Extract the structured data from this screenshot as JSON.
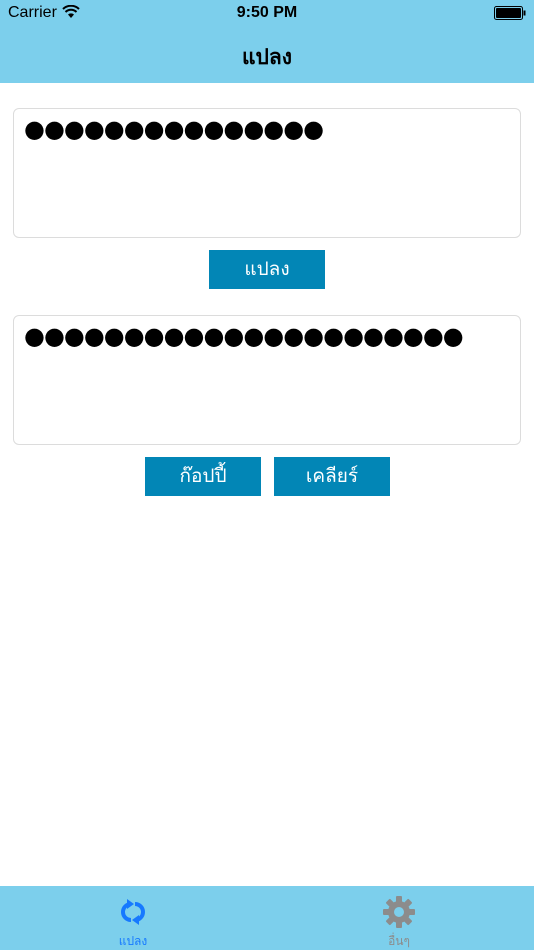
{
  "status_bar": {
    "carrier": "Carrier",
    "time": "9:50 PM"
  },
  "nav": {
    "title": "แปลง"
  },
  "input_box": {
    "value": "●●●●●●●●●●●●●●●"
  },
  "buttons": {
    "convert": "แปลง",
    "copy": "ก๊อปปี้",
    "clear": "เคลียร์"
  },
  "output_box": {
    "value": "●●●●●●●●●●●●●●●●●●●●●●"
  },
  "tabs": [
    {
      "label": "แปลง",
      "icon": "convert-arrows-icon",
      "selected": true
    },
    {
      "label": "อื่นๆ",
      "icon": "gear-icon",
      "selected": false
    }
  ],
  "colors": {
    "bar_background": "#7ccfec",
    "button": "#0286b6",
    "tab_active": "#1679ff",
    "tab_inactive": "#8c8c8c"
  }
}
